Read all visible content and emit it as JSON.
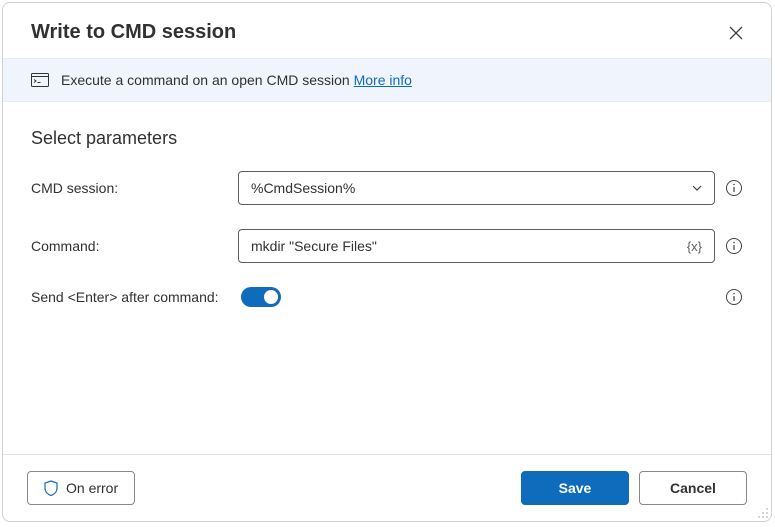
{
  "header": {
    "title": "Write to CMD session"
  },
  "banner": {
    "text": "Execute a command on an open CMD session",
    "link": "More info"
  },
  "section": {
    "title": "Select parameters"
  },
  "fields": {
    "session": {
      "label": "CMD session:",
      "value": "%CmdSession%"
    },
    "command": {
      "label": "Command:",
      "value": "mkdir \"Secure Files\"",
      "var_badge": "{x}"
    },
    "enter": {
      "label": "Send <Enter> after command:",
      "on": true
    }
  },
  "footer": {
    "on_error": "On error",
    "save": "Save",
    "cancel": "Cancel"
  }
}
